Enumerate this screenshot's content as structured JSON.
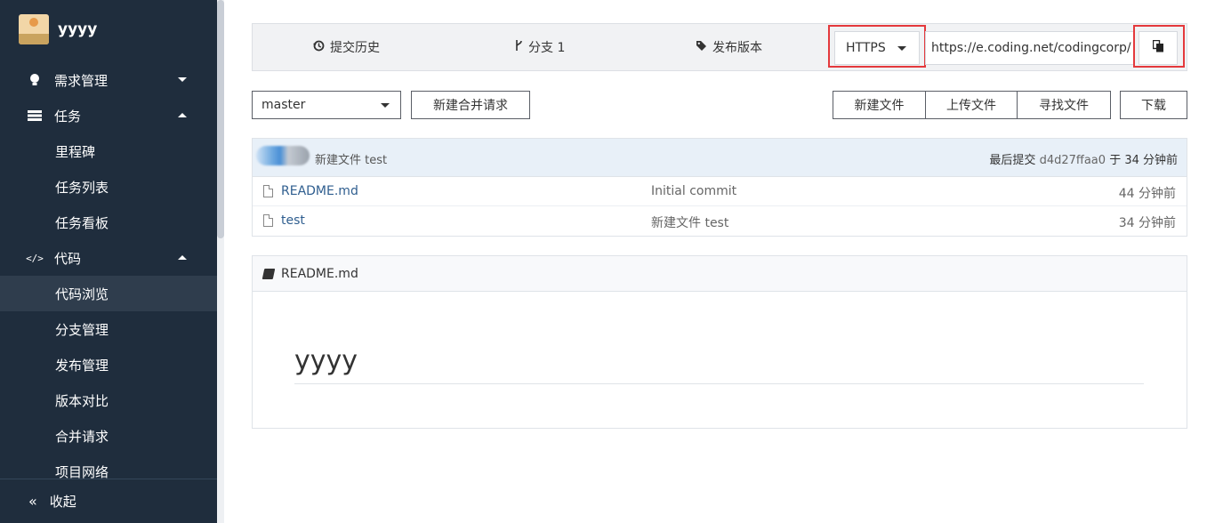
{
  "project": {
    "name": "yyyy"
  },
  "sidebar": {
    "items": [
      {
        "label": "需求管理",
        "icon": "lightbulb-icon",
        "caret": "down"
      },
      {
        "label": "任务",
        "icon": "task-list-icon",
        "caret": "up"
      },
      {
        "label": "里程碑",
        "sub": true
      },
      {
        "label": "任务列表",
        "sub": true
      },
      {
        "label": "任务看板",
        "sub": true
      },
      {
        "label": "代码",
        "icon": "code-icon",
        "caret": "up"
      },
      {
        "label": "代码浏览",
        "sub": true,
        "active": true
      },
      {
        "label": "分支管理",
        "sub": true
      },
      {
        "label": "发布管理",
        "sub": true
      },
      {
        "label": "版本对比",
        "sub": true
      },
      {
        "label": "合并请求",
        "sub": true
      },
      {
        "label": "项目网络",
        "sub": true
      }
    ],
    "collapse_label": "收起",
    "collapse_icon": "«"
  },
  "topbar": {
    "history_label": "提交历史",
    "branch_label": "分支 1",
    "release_label": "发布版本",
    "protocol": "HTTPS",
    "clone_url": "https://e.coding.net/codingcorp/",
    "copy_icon": "copy-icon",
    "highlight_color": "#e4393c"
  },
  "toolbar": {
    "branch": "master",
    "new_merge_request": "新建合并请求",
    "new_file": "新建文件",
    "upload_file": "上传文件",
    "find_file": "寻找文件",
    "download": "下载"
  },
  "files": {
    "latest_commit_message": "新建文件 test",
    "last_commit_prefix": "最后提交",
    "last_commit_hash": "d4d27ffaa0",
    "last_commit_time": "于 34 分钟前",
    "rows": [
      {
        "name": "README.md",
        "commit": "Initial commit",
        "time": "44 分钟前"
      },
      {
        "name": "test",
        "commit": "新建文件 test",
        "time": "34 分钟前"
      }
    ]
  },
  "readme": {
    "filename": "README.md",
    "heading": "yyyy"
  }
}
